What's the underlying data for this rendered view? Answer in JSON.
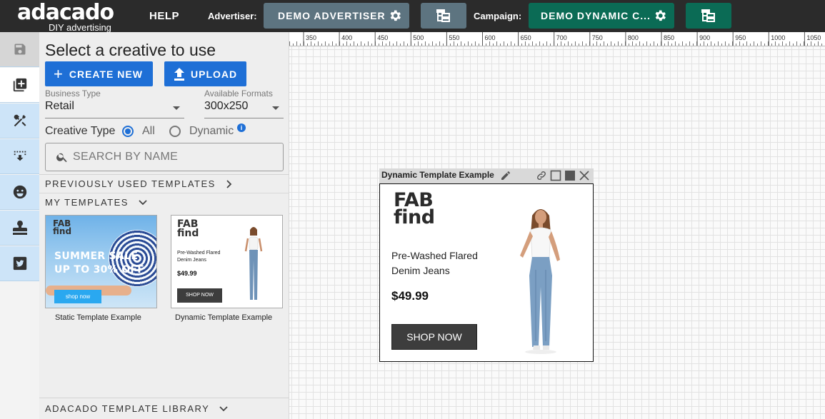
{
  "brand": {
    "logo_primary": "adacado",
    "logo_tag": "DIY advertising",
    "accent": "#7b1fd9"
  },
  "topbar": {
    "help": "HELP",
    "advertiser_label": "Advertiser:",
    "advertiser_name": "DEMO ADVERTISER",
    "campaign_label": "Campaign:",
    "campaign_name": "DEMO DYNAMIC C...",
    "advertiser_color": "#5d7480",
    "campaign_color": "#0b6b55"
  },
  "rail": {
    "items": [
      "save-icon",
      "add-creative-icon",
      "tools-icon",
      "download-icon",
      "emoji-icon",
      "stamp-icon",
      "twitter-icon"
    ]
  },
  "panel": {
    "title": "Select a creative to use",
    "create_new": "CREATE NEW",
    "upload": "UPLOAD",
    "business_type": {
      "label": "Business Type",
      "value": "Retail"
    },
    "available_formats": {
      "label": "Available Formats",
      "value": "300x250"
    },
    "creative_type": {
      "label": "Creative Type",
      "options": [
        "All",
        "Dynamic"
      ],
      "selected": "All"
    },
    "search": {
      "placeholder": "SEARCH BY NAME",
      "value": ""
    },
    "sections": {
      "previously_used": "PREVIOUSLY USED TEMPLATES",
      "my_templates": "MY TEMPLATES",
      "library": "ADACADO TEMPLATE LIBRARY"
    },
    "templates": [
      {
        "caption": "Static Template Example",
        "logo": [
          "FAB",
          "find"
        ],
        "headline": [
          "SUMMER SALE",
          "UP TO 30% OFF"
        ],
        "button": "shop now"
      },
      {
        "caption": "Dynamic Template Example",
        "logo": [
          "FAB",
          "find"
        ],
        "text": "Pre-Washed Flared Denim Jeans",
        "price": "$49.99",
        "button": "SHOP NOW"
      }
    ]
  },
  "canvas": {
    "ruler_labels": [
      "350",
      "400",
      "450",
      "500",
      "550",
      "600",
      "650",
      "700",
      "750",
      "800",
      "850",
      "900",
      "950",
      "1000",
      "1050"
    ],
    "widget": {
      "title": "Dynamic Template Example",
      "ad": {
        "logo_line1": "FAB",
        "logo_line2": "find",
        "product_line1": "Pre-Washed Flared",
        "product_line2": "Denim Jeans",
        "price": "$49.99",
        "button": "SHOP NOW"
      }
    }
  }
}
